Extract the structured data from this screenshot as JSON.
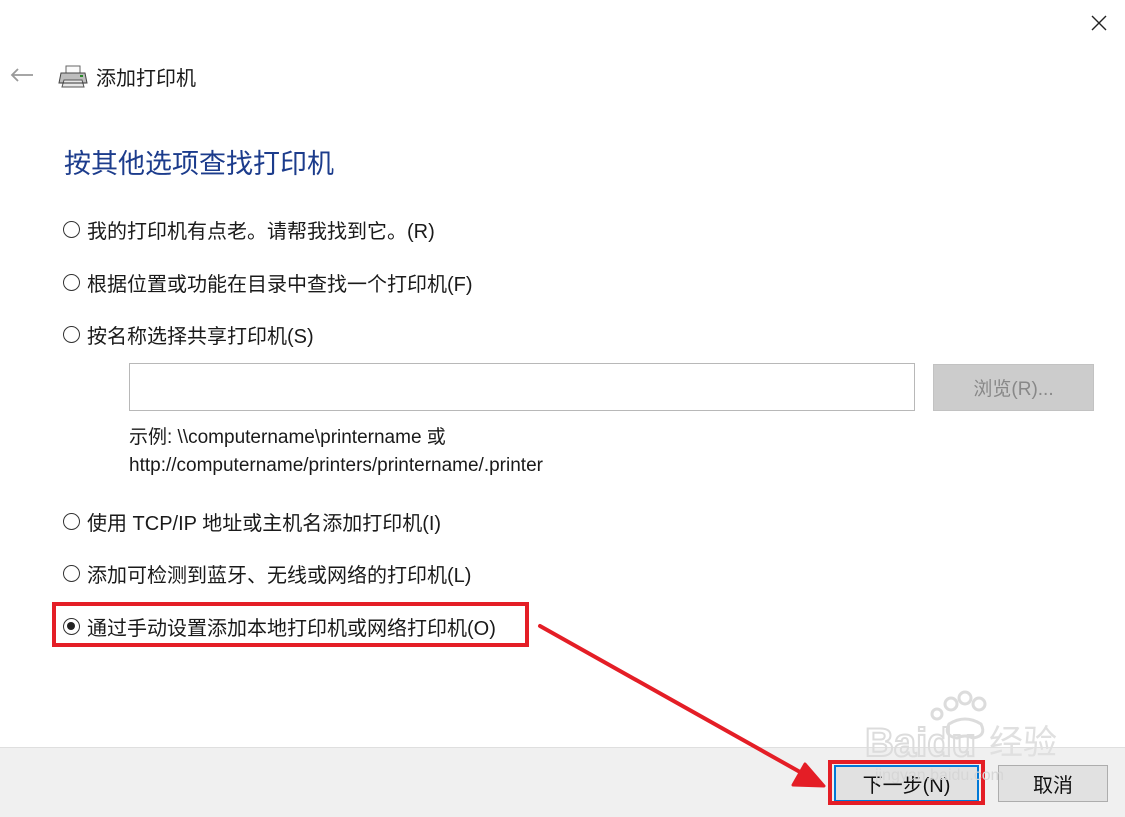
{
  "window": {
    "title": "添加打印机",
    "close_icon": "close-icon",
    "back_icon": "back-arrow-icon",
    "printer_icon": "printer-icon"
  },
  "heading": "按其他选项查找打印机",
  "options": [
    {
      "label": "我的打印机有点老。请帮我找到它。(R)",
      "checked": false
    },
    {
      "label": "根据位置或功能在目录中查找一个打印机(F)",
      "checked": false
    },
    {
      "label": "按名称选择共享打印机(S)",
      "checked": false
    },
    {
      "label": "使用 TCP/IP 地址或主机名添加打印机(I)",
      "checked": false
    },
    {
      "label": "添加可检测到蓝牙、无线或网络的打印机(L)",
      "checked": false
    },
    {
      "label": "通过手动设置添加本地打印机或网络打印机(O)",
      "checked": true
    }
  ],
  "share": {
    "input_value": "",
    "browse_label": "浏览(R)...",
    "example_line1": "示例: \\\\computername\\printername 或",
    "example_line2": "http://computername/printers/printername/.printer"
  },
  "footer": {
    "next_label": "下一步(N)",
    "cancel_label": "取消"
  },
  "annotation": {
    "highlight_color": "#e41e26"
  },
  "watermark": {
    "brand": "Baidu",
    "brand_cn": "经验",
    "site": "jingyan.baidu.com"
  },
  "colors": {
    "heading": "#1c3c8c",
    "accent": "#0078d7"
  }
}
